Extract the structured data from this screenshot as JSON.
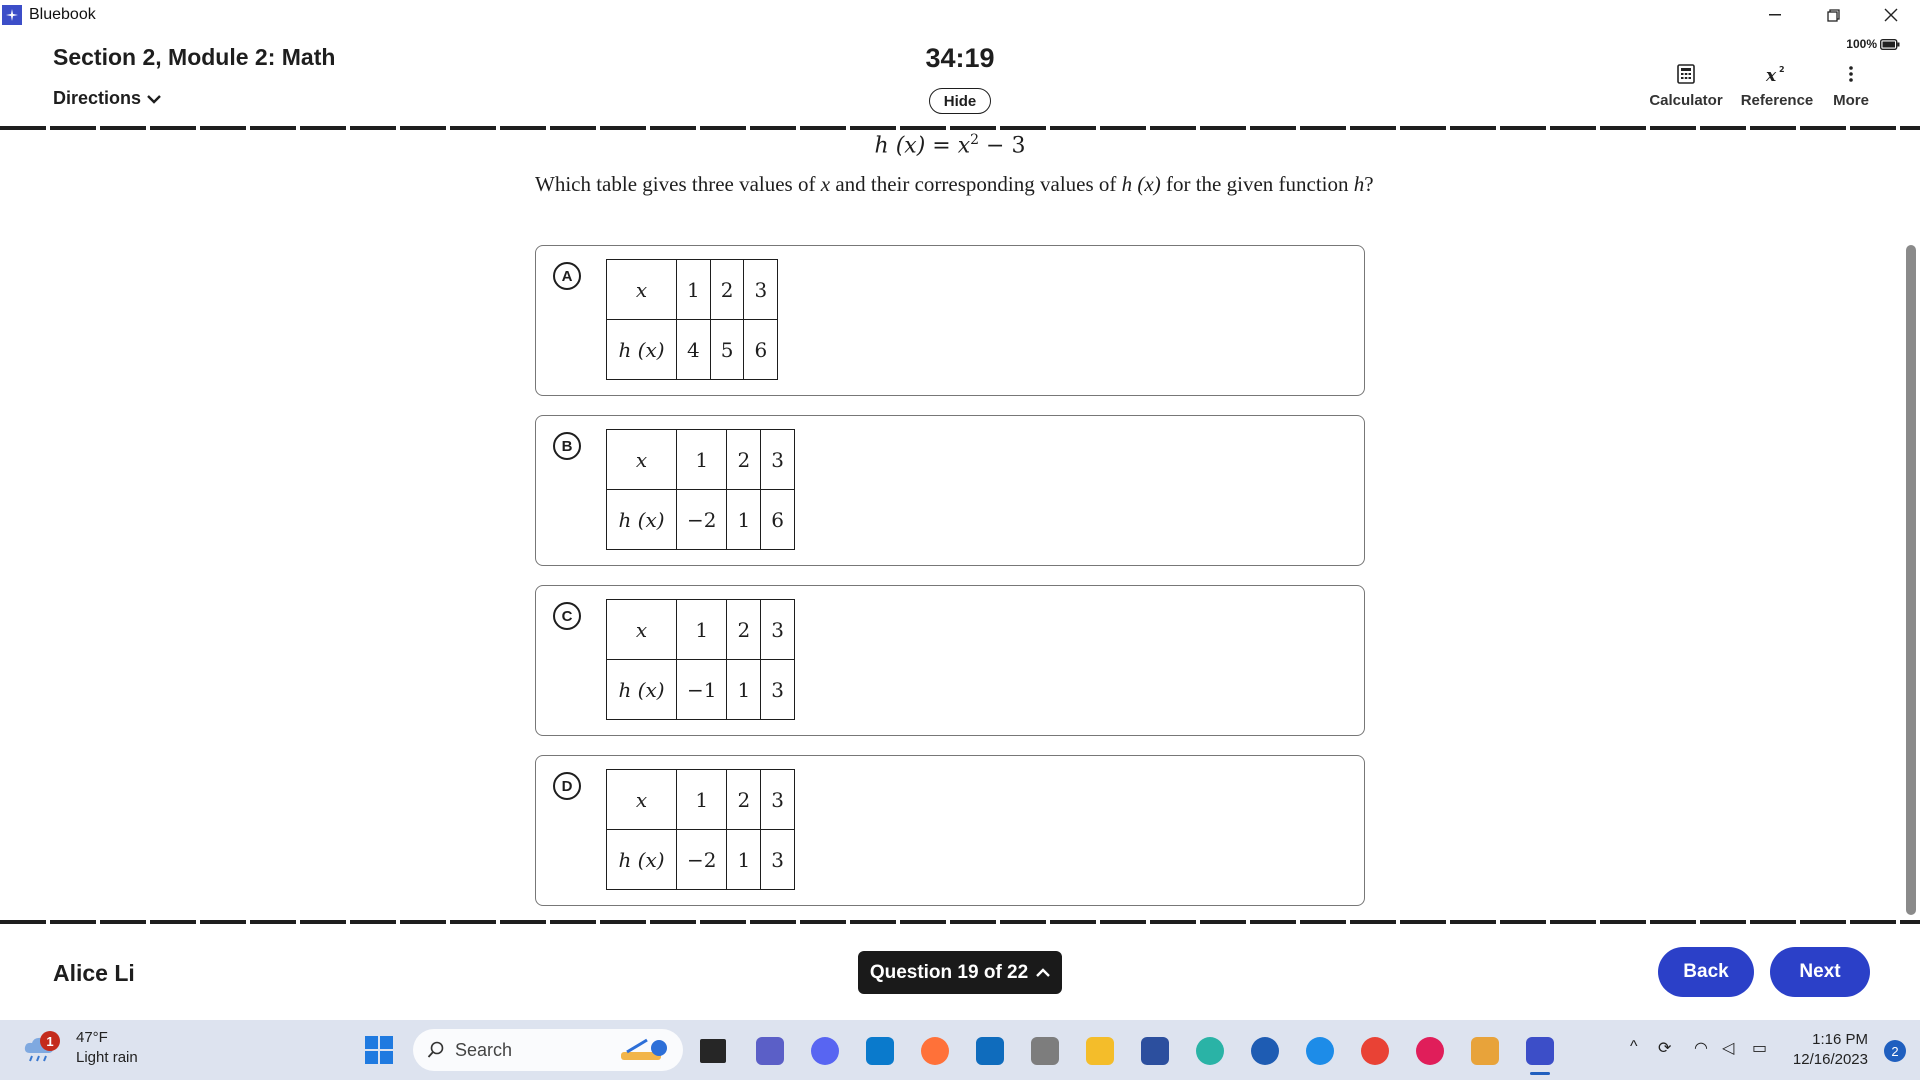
{
  "window": {
    "app_title": "Bluebook"
  },
  "header": {
    "section_title": "Section 2, Module 2: Math",
    "directions_label": "Directions",
    "timer": "34:19",
    "hide_label": "Hide",
    "battery": "100%",
    "tools": [
      {
        "label": "Calculator",
        "icon": "calculator-icon"
      },
      {
        "label": "Reference",
        "icon": "reference-icon"
      },
      {
        "label": "More",
        "icon": "more-vertical-icon"
      }
    ]
  },
  "question": {
    "equation": {
      "lhs": "h (x) = x",
      "exponent": "2",
      "rhs": " − 3"
    },
    "prompt_parts": [
      "Which table gives three values of ",
      "x",
      " and their corresponding values of ",
      "h (x)",
      " for the given function ",
      "h",
      "?"
    ],
    "choices": [
      {
        "letter": "A",
        "x_label": "x",
        "y_label": "h (x)",
        "x_values": [
          "1",
          "2",
          "3"
        ],
        "y_values": [
          "4",
          "5",
          "6"
        ]
      },
      {
        "letter": "B",
        "x_label": "x",
        "y_label": "h (x)",
        "x_values": [
          "1",
          "2",
          "3"
        ],
        "y_values": [
          "−2",
          "1",
          "6"
        ]
      },
      {
        "letter": "C",
        "x_label": "x",
        "y_label": "h (x)",
        "x_values": [
          "1",
          "2",
          "3"
        ],
        "y_values": [
          "−1",
          "1",
          "3"
        ]
      },
      {
        "letter": "D",
        "x_label": "x",
        "y_label": "h (x)",
        "x_values": [
          "1",
          "2",
          "3"
        ],
        "y_values": [
          "−2",
          "1",
          "3"
        ]
      }
    ]
  },
  "footer": {
    "student_name": "Alice Li",
    "question_nav": "Question 19 of 22",
    "back_label": "Back",
    "next_label": "Next"
  },
  "taskbar": {
    "weather_badge": "1",
    "temperature": "47°F",
    "condition": "Light rain",
    "search_placeholder": "Search",
    "time": "1:16 PM",
    "date": "12/16/2023",
    "notification_count": "2"
  },
  "colors": {
    "accent": "#2b40c8",
    "nav_dark": "#1a1a1a",
    "taskbar": "#dde3ef"
  }
}
